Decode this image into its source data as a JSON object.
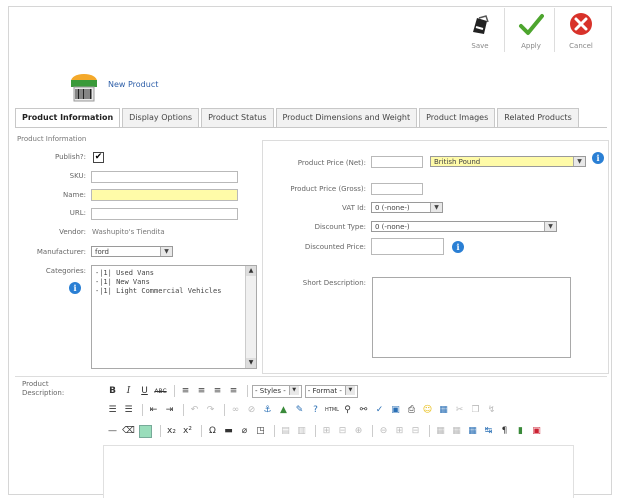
{
  "toolbar": {
    "save_label": "Save",
    "apply_label": "Apply",
    "cancel_label": "Cancel"
  },
  "header": {
    "title": "New Product"
  },
  "tabs": [
    {
      "label": "Product Information"
    },
    {
      "label": "Display Options"
    },
    {
      "label": "Product Status"
    },
    {
      "label": "Product Dimensions and Weight"
    },
    {
      "label": "Product Images"
    },
    {
      "label": "Related Products"
    }
  ],
  "info": {
    "legend": "Product Information",
    "publish_label": "Publish?:",
    "publish_checked": "✔",
    "sku_label": "SKU:",
    "name_label": "Name:",
    "url_label": "URL:",
    "vendor_label": "Vendor:",
    "vendor_value": "Washupito's Tiendita",
    "manufacturer_label": "Manufacturer:",
    "manufacturer_value": "ford",
    "categories_label": "Categories:",
    "categories": [
      "-|1| Used Vans",
      "-|1| New Vans",
      "-|1| Light Commercial Vehicles"
    ]
  },
  "pricing": {
    "price_net_label": "Product Price (Net):",
    "currency_value": "British Pound",
    "price_gross_label": "Product Price (Gross):",
    "vat_label": "VAT Id:",
    "vat_value": "0 (-none-)",
    "discount_type_label": "Discount Type:",
    "discount_type_value": "0 (-none-)",
    "discounted_price_label": "Discounted Price:",
    "short_desc_label": "Short Description:"
  },
  "editor": {
    "desc_label_1": "Product",
    "desc_label_2": "Description:",
    "styles_value": "- Styles -",
    "format_value": "- Format -"
  },
  "colors": {
    "highlight_input": "#fffba8",
    "info_icon": "#2a7fd4",
    "title_link": "#2d5ea8"
  }
}
